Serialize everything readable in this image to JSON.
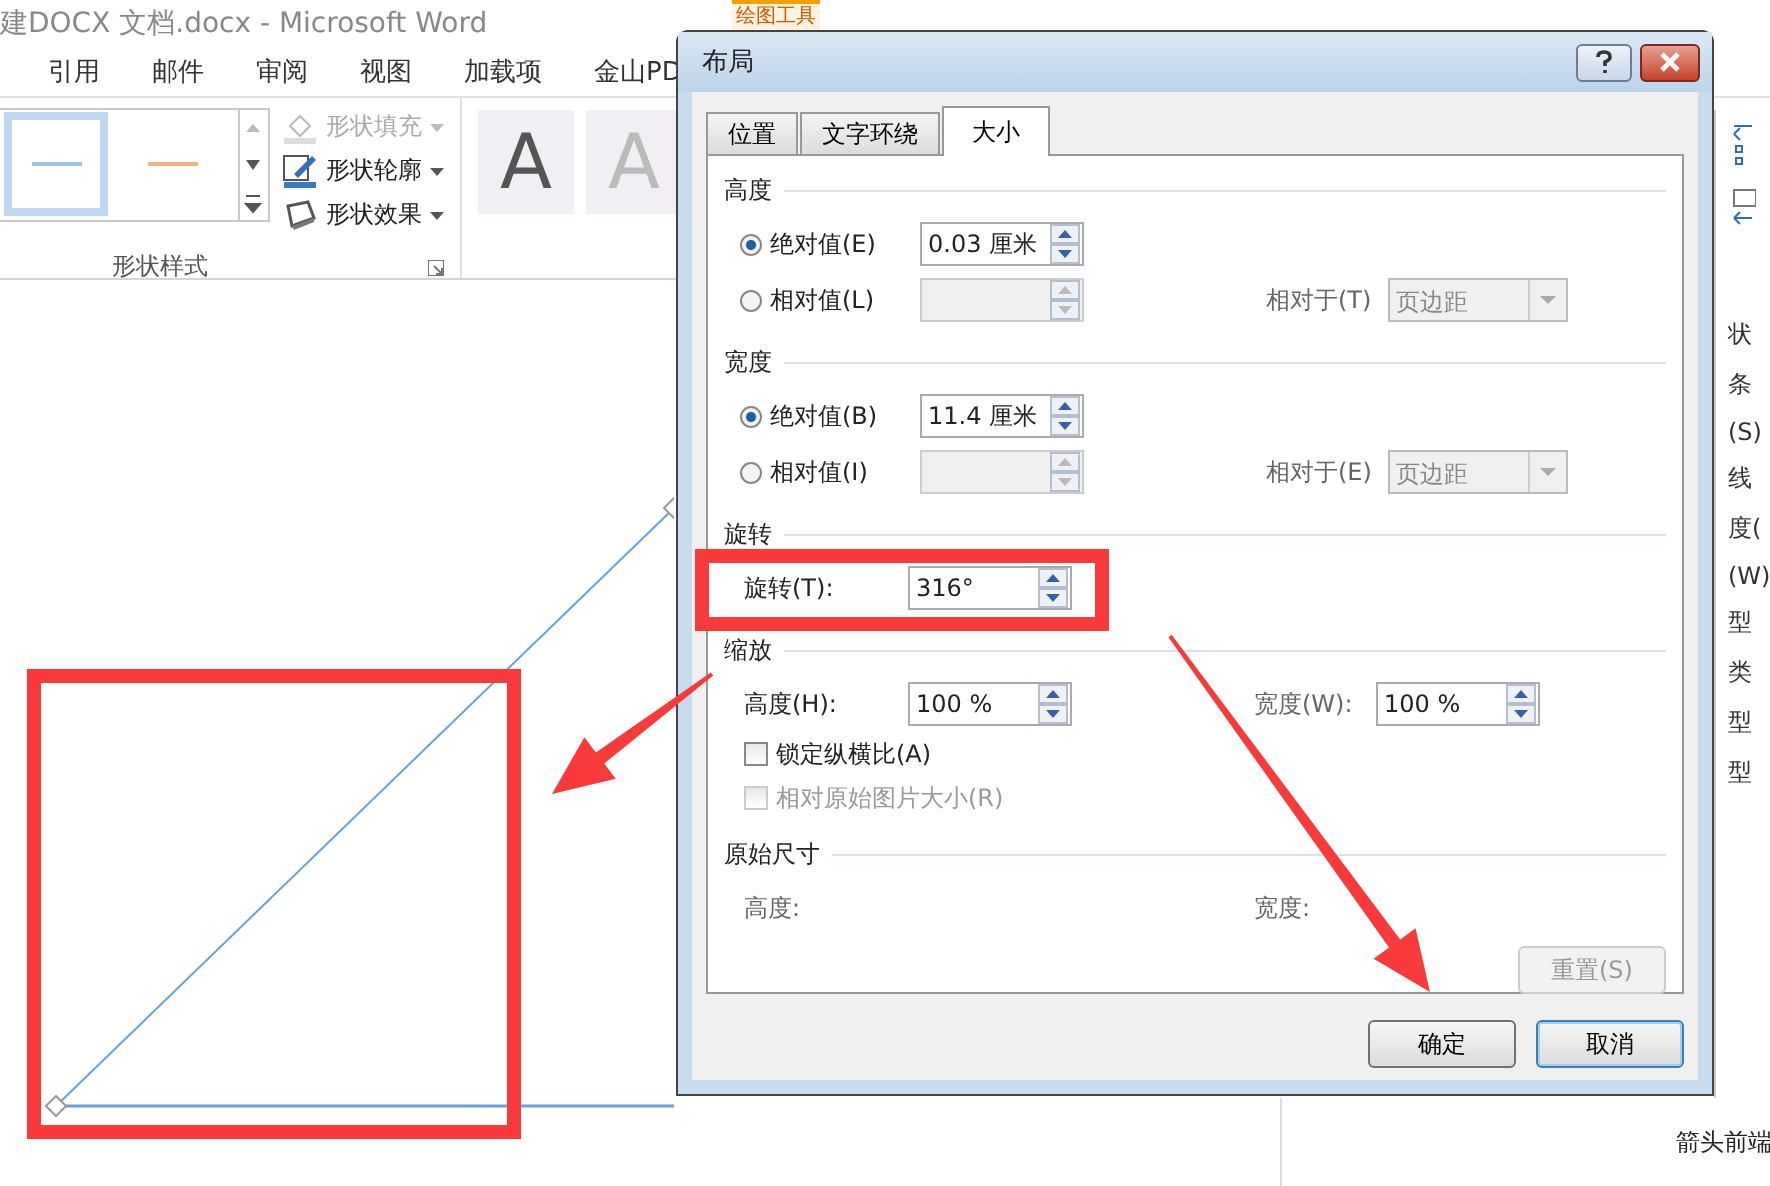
{
  "window": {
    "title": "建DOCX 文档.docx - Microsoft Word",
    "contextual_tab": "绘图工具"
  },
  "ribbon_tabs": [
    {
      "label": "引用"
    },
    {
      "label": "邮件"
    },
    {
      "label": "审阅"
    },
    {
      "label": "视图"
    },
    {
      "label": "加载项"
    },
    {
      "label": "金山PD"
    }
  ],
  "ribbon": {
    "styles": [
      {
        "color": "#9dc3e6",
        "selected": true
      },
      {
        "color": "#f4b183",
        "selected": false
      }
    ],
    "commands": [
      {
        "kind": "fill",
        "label": "形状填充",
        "disabled": true
      },
      {
        "kind": "outline",
        "label": "形状轮廓",
        "disabled": false
      },
      {
        "kind": "effect",
        "label": "形状效果",
        "disabled": false
      }
    ],
    "group_label": "形状样式",
    "wordart": [
      {
        "label": "A",
        "disabled": false
      },
      {
        "label": "A",
        "disabled": true
      }
    ]
  },
  "side_pane": {
    "fragments": [
      "状",
      "条",
      "(S)",
      "线",
      "度(",
      "(W)",
      "型",
      "类",
      "型",
      "型"
    ],
    "footer": "箭头前端"
  },
  "dialog": {
    "title": "布局",
    "tabs": [
      {
        "label": "位置",
        "selected": false
      },
      {
        "label": "文字环绕",
        "selected": false
      },
      {
        "label": "大小",
        "selected": true
      }
    ],
    "sections": [
      {
        "title": "高度",
        "rows": [
          {
            "kind": "radio",
            "label": "绝对值(E)",
            "selected": true,
            "field": {
              "value": "0.03 厘米",
              "disabled": false
            }
          },
          {
            "kind": "radio",
            "label": "相对值(L)",
            "selected": false,
            "field": {
              "disabled": true
            },
            "relative": {
              "label": "相对于(T)",
              "value": "页边距",
              "disabled": true
            }
          }
        ]
      },
      {
        "title": "宽度",
        "rows": [
          {
            "kind": "radio",
            "label": "绝对值(B)",
            "selected": true,
            "field": {
              "value": "11.4 厘米",
              "disabled": false
            }
          },
          {
            "kind": "radio",
            "label": "相对值(I)",
            "selected": false,
            "field": {
              "disabled": true
            },
            "relative": {
              "label": "相对于(E)",
              "value": "页边距",
              "disabled": true
            }
          }
        ]
      },
      {
        "title": "旋转",
        "rows": [
          {
            "kind": "spin",
            "label": "旋转(T):",
            "field": {
              "value": "316°",
              "disabled": false
            }
          }
        ]
      },
      {
        "title": "缩放",
        "rows": [
          {
            "kind": "pair",
            "items": [
              {
                "label": "高度(H):",
                "field": {
                  "value": "100 %",
                  "disabled": false
                }
              },
              {
                "label": "宽度(W):",
                "field": {
                  "value": "100 %",
                  "disabled": false
                }
              }
            ]
          },
          {
            "kind": "checkbox",
            "label": "锁定纵横比(A)",
            "checked": false,
            "disabled": false
          },
          {
            "kind": "checkbox",
            "label": "相对原始图片大小(R)",
            "checked": false,
            "disabled": true
          }
        ]
      },
      {
        "title": "原始尺寸",
        "rows": [
          {
            "kind": "info",
            "items": [
              {
                "label": "高度:"
              },
              {
                "label": "宽度:"
              }
            ]
          },
          {
            "kind": "button",
            "label": "重置(S)",
            "disabled": true
          }
        ]
      }
    ],
    "buttons": [
      {
        "label": "确定",
        "default": false
      },
      {
        "label": "取消",
        "default": true
      }
    ]
  }
}
